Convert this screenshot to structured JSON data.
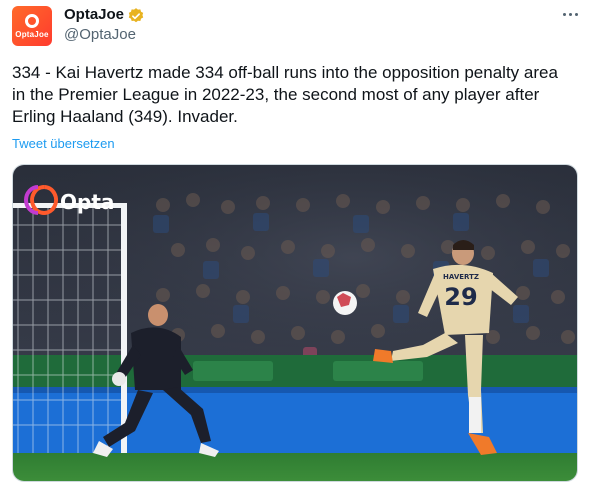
{
  "account": {
    "name": "OptaJoe",
    "handle": "@OptaJoe",
    "avatar_text": "OptaJoe",
    "avatar_color": "#ff5a2c",
    "verified_color": "#e8b321"
  },
  "tweet": {
    "text": "334 - Kai Havertz made 334 off-ball runs into the opposition penalty area in the Premier League in 2022-23, the second most of any player after Erling Haaland (349). Invader.",
    "translate_label": "Tweet übersetzen"
  },
  "media": {
    "logo_text": "Opta",
    "player_name": "HAVERTZ",
    "player_number": "29"
  },
  "icons": {
    "more": "more-horizontal-icon",
    "verified": "verified-badge-icon"
  },
  "colors": {
    "link": "#1d9bf0",
    "text": "#0f1419",
    "muted": "#536471"
  }
}
